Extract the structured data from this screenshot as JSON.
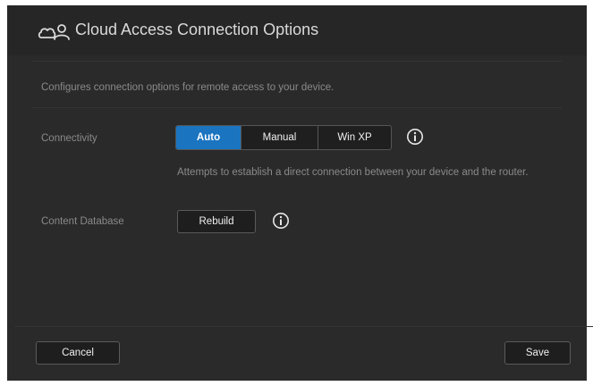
{
  "dialog": {
    "title": "Cloud Access Connection Options",
    "title_icon": "cloud-user-icon",
    "description": "Configures connection options for remote access to your device."
  },
  "connectivity": {
    "label": "Connectivity",
    "options": [
      "Auto",
      "Manual",
      "Win XP"
    ],
    "selected": "Auto",
    "hint": "Attempts to establish a direct connection between your device and the router.",
    "info_icon": "info-icon"
  },
  "content_database": {
    "label": "Content Database",
    "button_label": "Rebuild",
    "info_icon": "info-icon"
  },
  "footer": {
    "cancel_label": "Cancel",
    "save_label": "Save"
  },
  "colors": {
    "background": "#2a2a2a",
    "accent": "#1a74c0",
    "text_muted": "#8a8a8a",
    "text_light": "#f0f0f0"
  }
}
